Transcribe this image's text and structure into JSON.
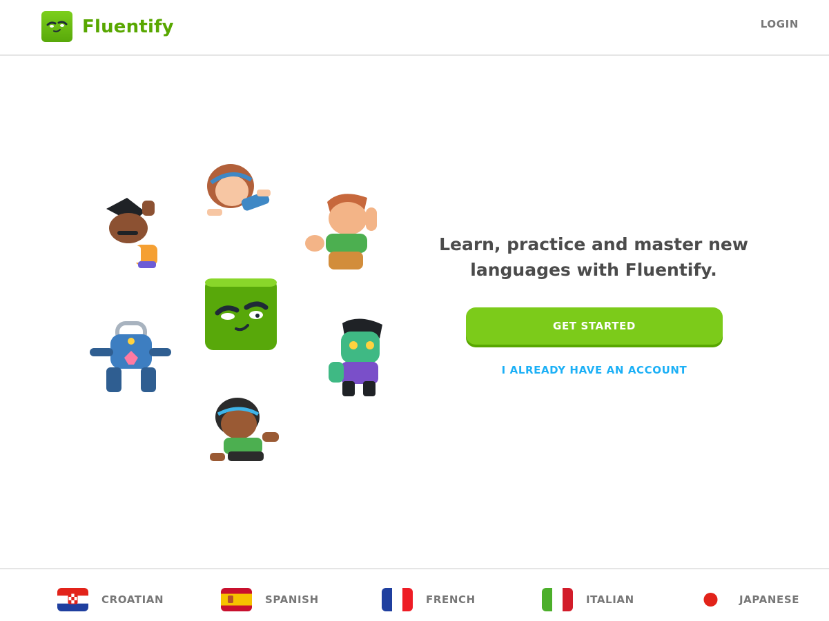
{
  "header": {
    "brand": "Fluentify",
    "login_label": "LOGIN"
  },
  "hero": {
    "headline": "Learn, practice and master new languages with Fluentify.",
    "get_started_label": "GET STARTED",
    "account_label": "I ALREADY HAVE AN ACCOUNT"
  },
  "languages": [
    {
      "label": "CROATIAN",
      "flag": "croatia-flag"
    },
    {
      "label": "SPANISH",
      "flag": "spain-flag"
    },
    {
      "label": "FRENCH",
      "flag": "france-flag"
    },
    {
      "label": "ITALIAN",
      "flag": "italy-flag"
    },
    {
      "label": "JAPANESE",
      "flag": "japan-flag"
    }
  ],
  "colors": {
    "brand_green": "#58a700",
    "button_green": "#7ccb1a",
    "link_blue": "#1cb0f6",
    "text_gray": "#777777"
  }
}
